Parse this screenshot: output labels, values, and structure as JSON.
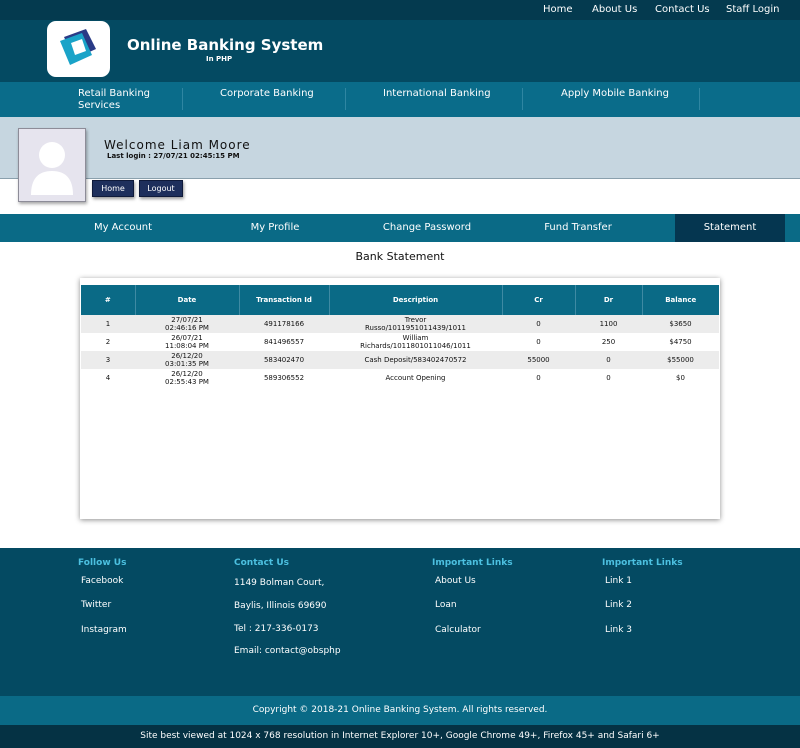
{
  "topnav": {
    "home": "Home",
    "about": "About Us",
    "contact": "Contact Us",
    "staff": "Staff Login"
  },
  "brand": {
    "title": "Online Banking System",
    "subtitle": "In PHP"
  },
  "categories": [
    "Retail Banking Services",
    "Corporate Banking",
    "International Banking",
    "Apply Mobile Banking"
  ],
  "welcome": {
    "greeting": "Welcome  Liam  Moore",
    "last_login": "Last login : 27/07/21 02:45:15 PM",
    "home_btn": "Home",
    "logout_btn": "Logout"
  },
  "tabs": [
    "My Account",
    "My Profile",
    "Change Password",
    "Fund Transfer",
    "Statement"
  ],
  "statement": {
    "title": "Bank Statement",
    "columns": [
      "#",
      "Date",
      "Transaction Id",
      "Description",
      "Cr",
      "Dr",
      "Balance"
    ],
    "rows": [
      {
        "num": "1",
        "date": "27/07/21 02:46:16 PM",
        "txn": "491178166",
        "desc": "Trevor Russo/1011951011439/1011",
        "cr": "0",
        "dr": "1100",
        "bal": "$3650"
      },
      {
        "num": "2",
        "date": "26/07/21 11:08:04 PM",
        "txn": "841496557",
        "desc": "William Richards/1011801011046/1011",
        "cr": "0",
        "dr": "250",
        "bal": "$4750"
      },
      {
        "num": "3",
        "date": "26/12/20 03:01:35 PM",
        "txn": "583402470",
        "desc": "Cash Deposit/583402470572",
        "cr": "55000",
        "dr": "0",
        "bal": "$55000"
      },
      {
        "num": "4",
        "date": "26/12/20 02:55:43 PM",
        "txn": "589306552",
        "desc": "Account Opening",
        "cr": "0",
        "dr": "0",
        "bal": "$0"
      }
    ]
  },
  "footer": {
    "follow": {
      "heading": "Follow Us",
      "items": [
        "Facebook",
        "Twitter",
        "Instagram"
      ]
    },
    "contact": {
      "heading": "Contact Us",
      "items": [
        "1149 Bolman Court,",
        "Baylis, Illinois 69690",
        "Tel : 217-336-0173",
        "Email: contact@obsphp"
      ]
    },
    "links1": {
      "heading": "Important Links",
      "items": [
        "About Us",
        "Loan",
        "Calculator"
      ]
    },
    "links2": {
      "heading": "Important Links",
      "items": [
        "Link 1",
        "Link 2",
        "Link 3"
      ]
    },
    "copyright": "Copyright © 2018-21 Online Banking System. All rights reserved.",
    "best_viewed": "Site best viewed at 1024 x 768 resolution in Internet Explorer 10+, Google Chrome 49+, Firefox 45+ and Safari 6+"
  },
  "colors": {
    "header": "#044a62",
    "bar": "#0a6a86",
    "active_tab": "#053650",
    "footer_heading": "#4cc0e0"
  }
}
